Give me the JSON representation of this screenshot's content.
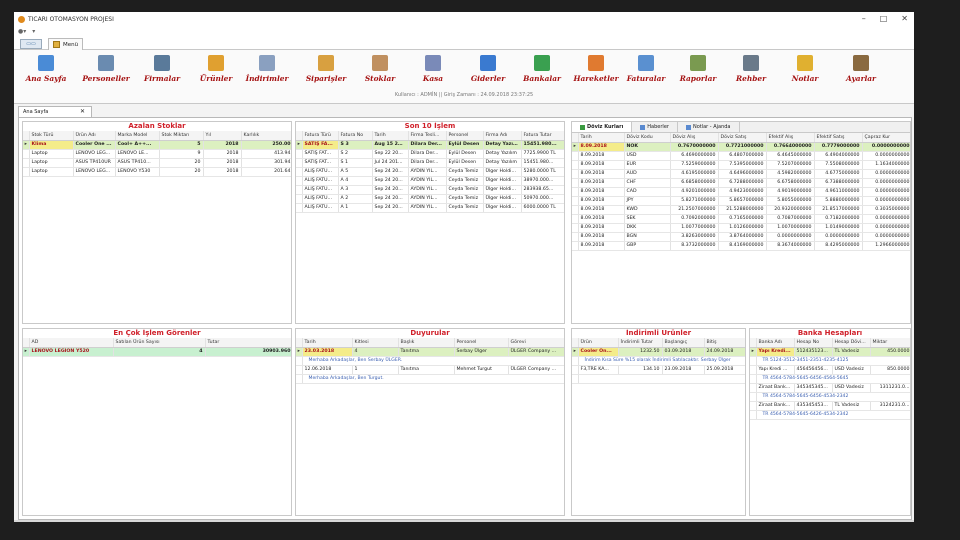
{
  "app": {
    "title": "TICARI OTOMASYON PROJESI",
    "tab_menu": "Menü",
    "doc_tab": "Ana Sayfa"
  },
  "ribbon": {
    "buttons": [
      {
        "label": "Ana Sayfa",
        "icon": "home-icon",
        "color": "#4a8bd6"
      },
      {
        "label": "Personeller",
        "icon": "person-icon",
        "color": "#6a8bb0"
      },
      {
        "label": "Firmalar",
        "icon": "company-icon",
        "color": "#5a7a9a"
      },
      {
        "label": "Ürünler",
        "icon": "box-icon",
        "color": "#e0a030"
      },
      {
        "label": "İndirimler",
        "icon": "chart-icon",
        "color": "#8aa0c0"
      },
      {
        "label": "Siparişler",
        "icon": "order-icon",
        "color": "#d8a040"
      },
      {
        "label": "Stoklar",
        "icon": "stock-icon",
        "color": "#c09060"
      },
      {
        "label": "Kasa",
        "icon": "safe-icon",
        "color": "#7a8ab8"
      },
      {
        "label": "Giderler",
        "icon": "expense-icon",
        "color": "#3a7ad0"
      },
      {
        "label": "Bankalar",
        "icon": "bank-icon",
        "color": "#3aa050"
      },
      {
        "label": "Hareketler",
        "icon": "movement-icon",
        "color": "#e07a30"
      },
      {
        "label": "Faturalar",
        "icon": "invoice-icon",
        "color": "#5a90d0"
      },
      {
        "label": "Raporlar",
        "icon": "report-icon",
        "color": "#7a9a50"
      },
      {
        "label": "Rehber",
        "icon": "book-icon",
        "color": "#6a7a8a"
      },
      {
        "label": "Notlar",
        "icon": "note-icon",
        "color": "#e0b030"
      },
      {
        "label": "Ayarlar",
        "icon": "settings-icon",
        "color": "#8a6a40"
      }
    ]
  },
  "status": {
    "text": "Kullanıcı : ADMİN   ||   Giriş Zamanı : 24.09.2018 23:37:25"
  },
  "azalan": {
    "title": "Azalan Stoklar",
    "headers": [
      "Stok Türü",
      "Ürün Adı",
      "Marka Model",
      "Stok Miktarı",
      "Yıl",
      "Karlılık"
    ],
    "rows": [
      [
        "Klima",
        "Cooler One ...",
        "Cool+ A++...",
        "5",
        "2018",
        "250.00"
      ],
      [
        "Laptop",
        "LENOVO LEG...",
        "LENOVO LE...",
        "9",
        "2018",
        "413.94"
      ],
      [
        "Laptop",
        "ASUS TP410UR",
        "ASUS TP410...",
        "20",
        "2018",
        "301.94"
      ],
      [
        "Laptop",
        "LENOVO LEG...",
        "LENOVO Y530",
        "20",
        "2018",
        "201.64"
      ]
    ]
  },
  "son10": {
    "title": "Son 10 İşlem",
    "headers": [
      "Fatura Türü",
      "Fatura No",
      "Tarih",
      "Firma Tesli...",
      "Personel",
      "Firma Adı",
      "Fatura Tutar"
    ],
    "rows": [
      [
        "SATIŞ FA...",
        "S 3",
        "Aug 15 20...",
        "Dilara Der...",
        "Eylül Desen",
        "Detay Yazılım",
        "15451.980..."
      ],
      [
        "SATIŞ FAT...",
        "S 2",
        "Sep 22 20...",
        "Dilara Der...",
        "Eylül Desen",
        "Detay Yazılım",
        "7725.9900 TL"
      ],
      [
        "SATIŞ FAT...",
        "S 1",
        "Jul 24 201...",
        "Dilara Der...",
        "Eylül Desen",
        "Detay Yazılım",
        "15451.980..."
      ],
      [
        "ALIŞ FATU...",
        "A 5",
        "Sep 24 20...",
        "AYDIN YIL...",
        "Ceyda Temiz",
        "Ülger Holdi...",
        "5280.0000 TL"
      ],
      [
        "ALIŞ FATU...",
        "A 4",
        "Sep 24 20...",
        "AYDIN YIL...",
        "Ceyda Temiz",
        "Ülger Holdi...",
        "38970.000..."
      ],
      [
        "ALIŞ FATU...",
        "A 3",
        "Sep 24 20...",
        "AYDIN YIL...",
        "Ceyda Temiz",
        "Ülger Holdi...",
        "283938.65..."
      ],
      [
        "ALIŞ FATU...",
        "A 2",
        "Sep 24 20...",
        "AYDIN YIL...",
        "Ceyda Temiz",
        "Ülger Holdi...",
        "50970.000..."
      ],
      [
        "ALIŞ FATU...",
        "A 1",
        "Sep 24 20...",
        "AYDIN YIL...",
        "Ceyda Temiz",
        "Ülger Holdi...",
        "6000.0000 TL"
      ]
    ]
  },
  "doviz": {
    "tabs": [
      "Döviz Kurları",
      "Haberler",
      "Notlar - Ajanda"
    ],
    "headers": [
      "Tarih",
      "Döviz Kodu",
      "Döviz Alış",
      "Döviz Satış",
      "Efektif Alış",
      "Efektif Satış",
      "Çapraz Kur"
    ],
    "rows": [
      [
        "8.09.2018",
        "NOK",
        "0.7670000000",
        "0.7721000000",
        "0.7664000000",
        "0.7779000000",
        "0.0000000000"
      ],
      [
        "8.09.2018",
        "USD",
        "6.4690000000",
        "6.4807000000",
        "6.4645000000",
        "6.4904000000",
        "0.0000000000"
      ],
      [
        "8.09.2018",
        "EUR",
        "7.5259000000",
        "7.5395000000",
        "7.5207000000",
        "7.5508000000",
        "1.1634000000"
      ],
      [
        "8.09.2018",
        "AUD",
        "4.6195000000",
        "4.6496000000",
        "4.5982000000",
        "4.6775000000",
        "0.0000000000"
      ],
      [
        "8.09.2018",
        "CHF",
        "6.6858000000",
        "6.7288000000",
        "6.6758000000",
        "6.7388000000",
        "0.0000000000"
      ],
      [
        "8.09.2018",
        "CAD",
        "4.9201000000",
        "4.9423000000",
        "4.9019000000",
        "4.9611000000",
        "0.0000000000"
      ],
      [
        "8.09.2018",
        "JPY",
        "5.8271000000",
        "5.8657000000",
        "5.8055000000",
        "5.8880000000",
        "0.0000000000"
      ],
      [
        "8.09.2018",
        "KWD",
        "21.2507000000",
        "21.5288000000",
        "20.9320000000",
        "21.8517000000",
        "0.3035000000"
      ],
      [
        "8.09.2018",
        "SEK",
        "0.7092000000",
        "0.7165000000",
        "0.7087000000",
        "0.7182000000",
        "0.0000000000"
      ],
      [
        "8.09.2018",
        "DKK",
        "1.0077000000",
        "1.0126000000",
        "1.0070000000",
        "1.0149000000",
        "0.0000000000"
      ],
      [
        "8.09.2018",
        "BGN",
        "3.8263000000",
        "3.8764000000",
        "0.0000000000",
        "0.0000000000",
        "0.0000000000"
      ],
      [
        "8.09.2018",
        "GBP",
        "8.3732000000",
        "8.4169000000",
        "8.3674000000",
        "8.4295000000",
        "1.2966000000"
      ]
    ]
  },
  "encok": {
    "title": "En Çok İşlem Görenler",
    "headers": [
      "AD",
      "Satılan Ürün Sayısı",
      "Tutar"
    ],
    "rows": [
      [
        "LENOVO LEGION Y520",
        "4",
        "30903.960"
      ]
    ]
  },
  "duyuru": {
    "title": "Duyurular",
    "headers": [
      "Tarih",
      "Kitlesi",
      "Başlık",
      "Personel",
      "Görevi"
    ],
    "rows": [
      {
        "cells": [
          "23.03.2018",
          "4",
          "Tanıtma",
          "Serbay Ülger",
          "ÜLGER Company ..."
        ],
        "detail": "Merhaba Arkadaşlar, Ben Serbay ÜLGER."
      },
      {
        "cells": [
          "12.06.2018",
          "1",
          "Tanıtma",
          "Mehmet Turgut",
          "ÜLGER Company ..."
        ],
        "detail": "Merhaba Arkadaşlar, Ben Turgut."
      }
    ]
  },
  "indirim": {
    "title": "İndirimli Ürünler",
    "headers": [
      "Ürün",
      "İndirimli Tutar",
      "Başlangıç",
      "Bitiş"
    ],
    "rows": [
      {
        "cells": [
          "Cooler On...",
          "1232.50",
          "03.09.2018",
          "24.09.2018"
        ],
        "detail": "İndirim Kısa Süre %15 olarak İndirimli Satılacaktır. Serbay Ülger"
      },
      {
        "cells": [
          "F3,TRE KA...",
          "134.10",
          "23.09.2018",
          "25.09.2018"
        ],
        "detail": ""
      }
    ]
  },
  "banka": {
    "title": "Banka Hesapları",
    "headers": [
      "Banka Adı",
      "Hesap No",
      "Hesap Dövi...",
      "Miktar"
    ],
    "rows": [
      {
        "cells": [
          "Yapı Kredi...",
          "512435123...",
          "TL Vadesiz",
          "450.0000"
        ],
        "detail": "TR 5124-3512-3451-2351-4235-4125"
      },
      {
        "cells": [
          "Yapı Kredi ...",
          "456456456...",
          "USD Vadesiz",
          "850.0000"
        ],
        "detail": "TR 4564-5784-5645-6456-4564-5645"
      },
      {
        "cells": [
          "Ziraat Bank...",
          "345345345...",
          "USD Vadesiz",
          "1311231.0..."
        ],
        "detail": "TR 4564-5784-5645-6456-4534-2342"
      },
      {
        "cells": [
          "Ziraat Bank...",
          "435345453...",
          "TL Vadesiz",
          "3124231.0..."
        ],
        "detail": "TR 4564-5784-5645-6426-4534-2342"
      }
    ]
  }
}
